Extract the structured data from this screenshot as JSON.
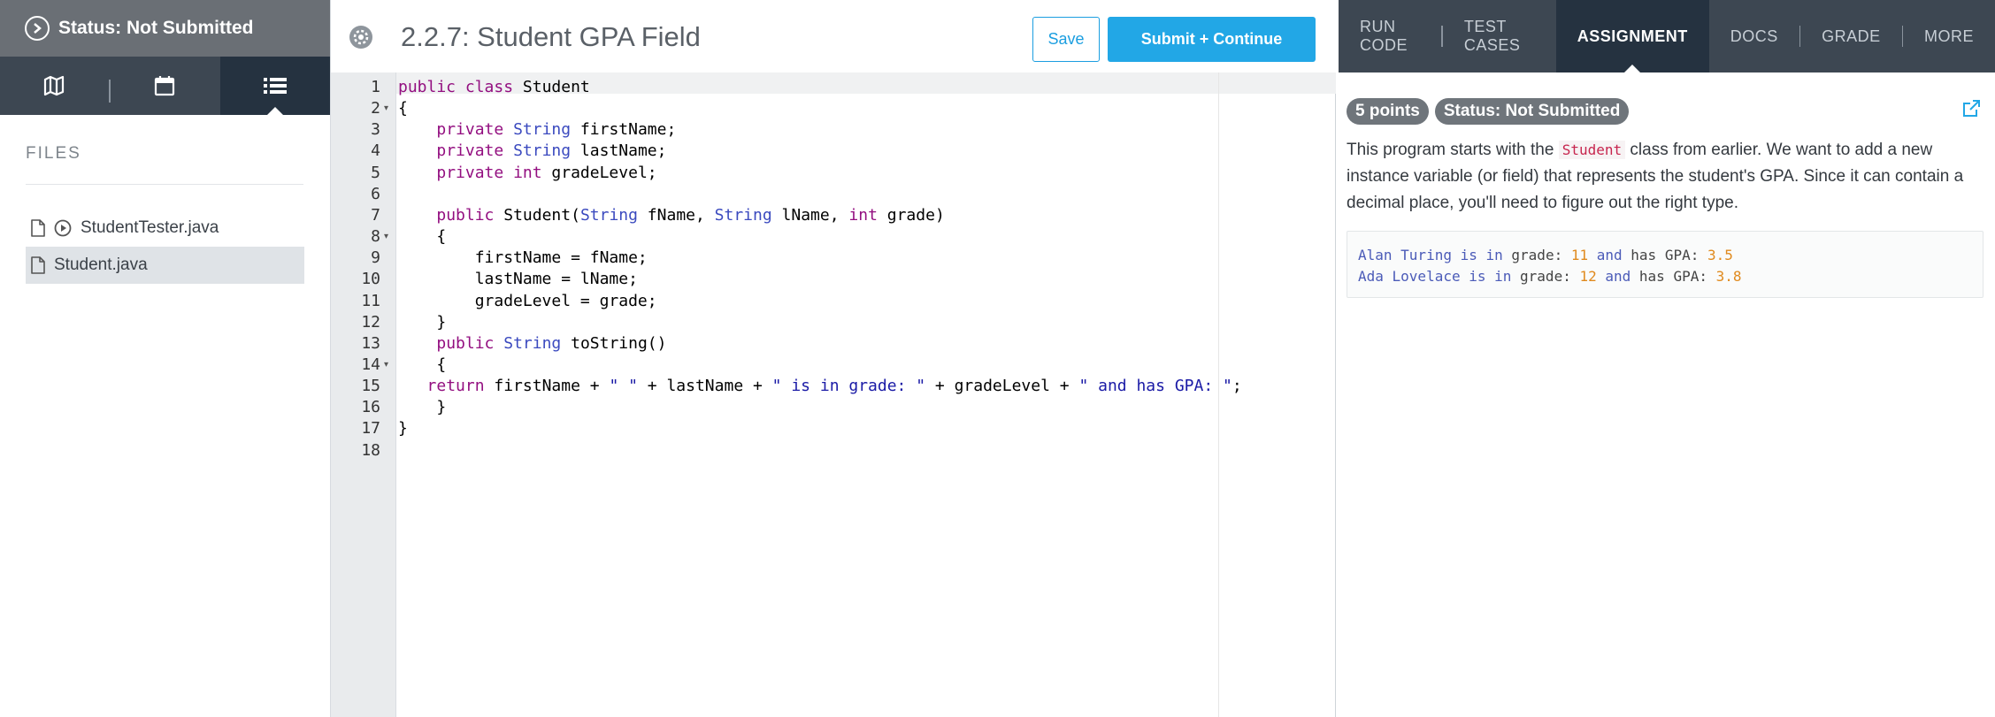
{
  "sidebar": {
    "status": "Status: Not Submitted",
    "nav": [
      {
        "icon": "map-icon"
      },
      {
        "icon": "calendar-icon"
      },
      {
        "icon": "list-icon"
      }
    ],
    "files_label": "FILES",
    "files": [
      {
        "name": "StudentTester.java",
        "runnable": true,
        "active": false
      },
      {
        "name": "Student.java",
        "runnable": false,
        "active": true
      }
    ]
  },
  "editor": {
    "title": "2.2.7: Student GPA Field",
    "save_label": "Save",
    "submit_label": "Submit + Continue",
    "line_numbers": [
      "1",
      "2",
      "3",
      "4",
      "5",
      "6",
      "7",
      "8",
      "9",
      "10",
      "11",
      "12",
      "13",
      "14",
      "15",
      "16",
      "17",
      "18"
    ],
    "fold_lines": [
      2,
      8,
      14
    ],
    "code": [
      "public class Student",
      "{",
      "    private String firstName;",
      "    private String lastName;",
      "    private int gradeLevel;",
      "",
      "    public Student(String fName, String lName, int grade)",
      "    {",
      "        firstName = fName;",
      "        lastName = lName;",
      "        gradeLevel = grade;",
      "    }",
      "    public String toString()",
      "    {",
      "   return firstName + \" \" + lastName + \" is in grade: \" + gradeLevel + \" and has GPA: \";",
      "    }",
      "}",
      ""
    ]
  },
  "right": {
    "tabs": [
      "RUN CODE",
      "TEST CASES",
      "ASSIGNMENT",
      "DOCS",
      "GRADE",
      "MORE"
    ],
    "active_tab": "ASSIGNMENT",
    "points_badge": "5 points",
    "status_badge": "Status: Not Submitted",
    "assignment_before": "This program starts with the ",
    "assignment_code": "Student",
    "assignment_after": " class from earlier. We want to add a new instance variable (or field) that represents the student's GPA. Since it can contain a decimal place, you'll need to figure out the right type.",
    "sample_output": [
      {
        "name": "Alan Turing",
        "mid": " is in grade: ",
        "grade": "11",
        "mid2": " and has GPA: ",
        "gpa": "3.5"
      },
      {
        "name": "Ada Lovelace",
        "mid": " is in grade: ",
        "grade": "12",
        "mid2": " and has GPA: ",
        "gpa": "3.8"
      }
    ]
  },
  "colors": {
    "accent": "#22a7e6",
    "nav_dark": "#3d4752",
    "nav_active": "#253240",
    "status_gray": "#6a6f75"
  }
}
